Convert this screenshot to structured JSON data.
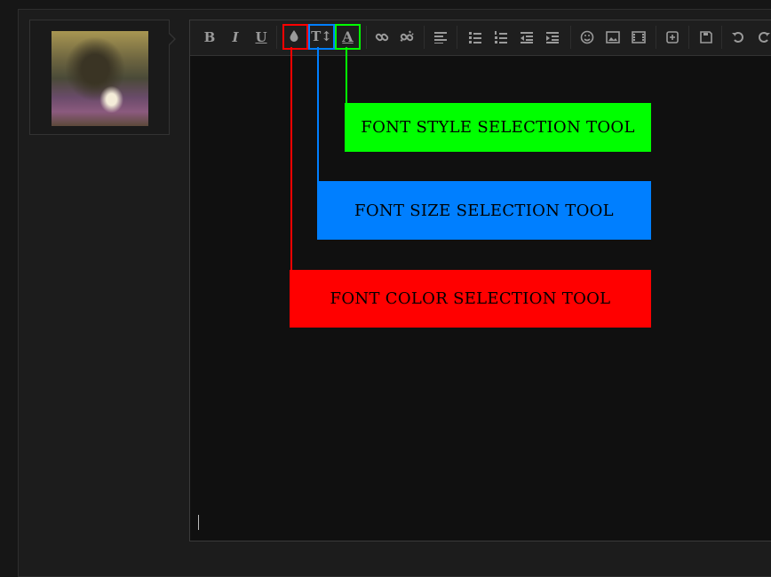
{
  "user": {
    "avatar_icon": "user-avatar-image"
  },
  "toolbar": {
    "bold_label": "B",
    "italic_label": "I",
    "underline_label": "U",
    "font_size_label": "T↕",
    "font_style_label": "A",
    "icons": [
      "bold-icon",
      "italic-icon",
      "underline-icon",
      "color-drop-icon",
      "font-size-icon",
      "font-style-icon",
      "link-icon",
      "unlink-icon",
      "align-icon",
      "bullet-list-icon",
      "numbered-list-icon",
      "outdent-icon",
      "indent-icon",
      "smiley-icon",
      "image-icon",
      "video-icon",
      "insert-icon",
      "save-icon",
      "undo-icon",
      "redo-icon"
    ]
  },
  "callouts": {
    "style": {
      "label": "FONT STYLE SELECTION TOOL",
      "color": "#00ff00"
    },
    "size": {
      "label": "FONT SIZE SELECTION TOOL",
      "color": "#007fff"
    },
    "color": {
      "label": "FONT COLOR SELECTION TOOL",
      "color": "#ff0000"
    }
  }
}
